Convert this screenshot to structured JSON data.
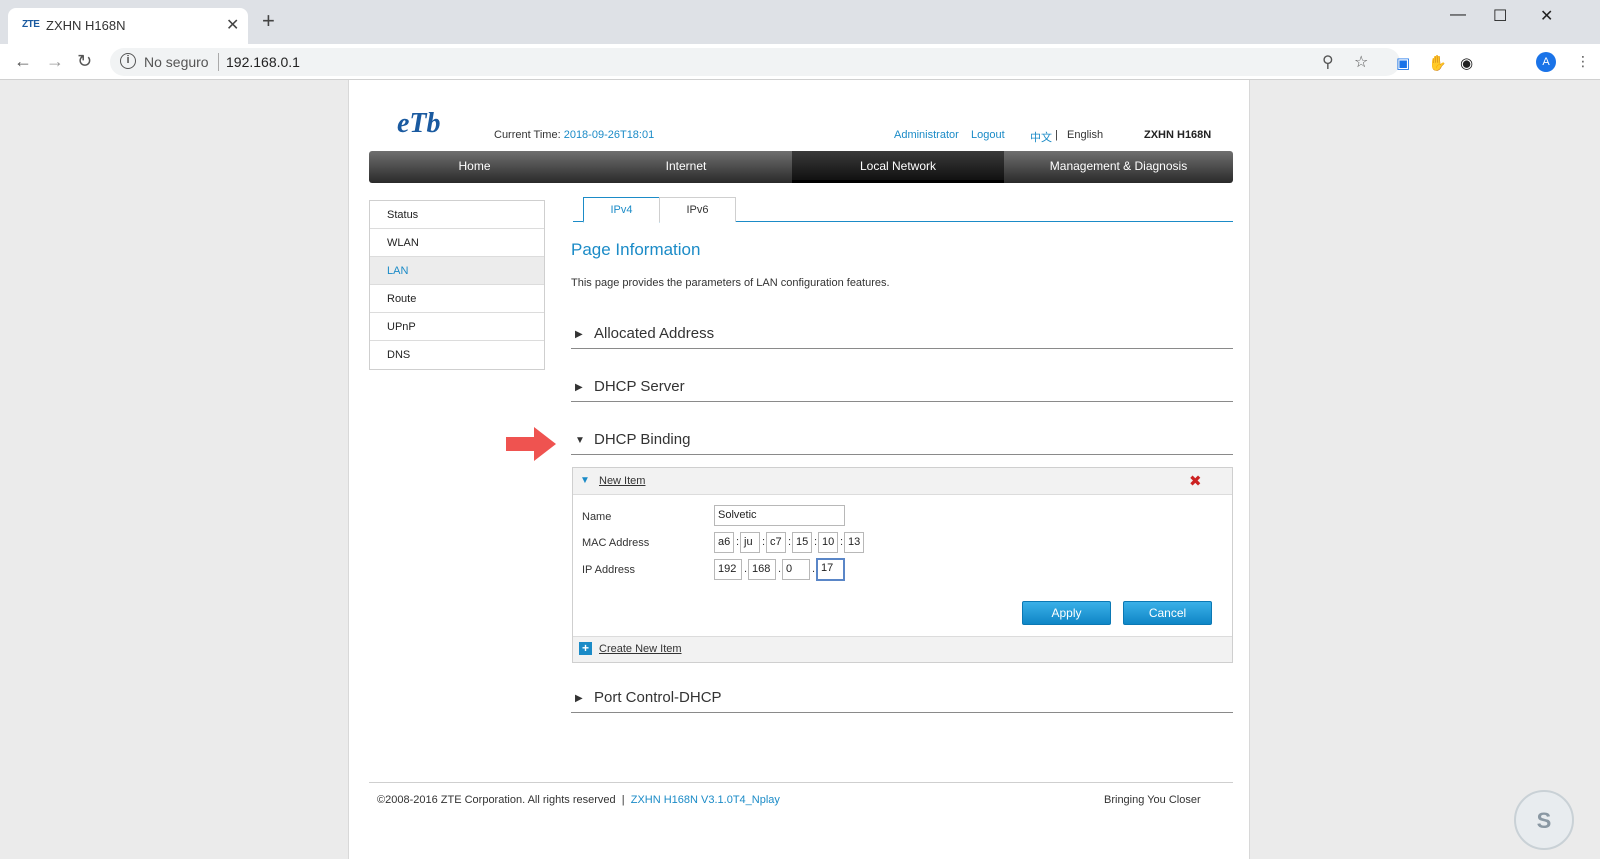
{
  "browser": {
    "tab_favicon": "ZTE",
    "tab_title": "ZXHN H168N",
    "tab_close": "✕",
    "new_tab": "+",
    "security_label": "No seguro",
    "url": "192.168.0.1",
    "avatar_letter": "A",
    "window_controls": [
      "—",
      "☐",
      "✕"
    ]
  },
  "header": {
    "logo": "eTb",
    "current_time_label": "Current Time:",
    "current_time_value": "2018-09-26T18:01",
    "user": "Administrator",
    "logout": "Logout",
    "lang_cn": "中文",
    "lang_sep": "|",
    "lang_en": "English",
    "model": "ZXHN H168N"
  },
  "nav": {
    "items": [
      "Home",
      "Internet",
      "Local Network",
      "Management & Diagnosis"
    ],
    "active": "Local Network"
  },
  "sidebar": {
    "items": [
      "Status",
      "WLAN",
      "LAN",
      "Route",
      "UPnP",
      "DNS"
    ],
    "active": "LAN"
  },
  "subtabs": [
    "IPv4",
    "IPv6"
  ],
  "page_info": {
    "title": "Page Information",
    "description": "This page provides the parameters of LAN configuration features."
  },
  "sections": {
    "allocated": "Allocated Address",
    "dhcp_server": "DHCP Server",
    "dhcp_binding": "DHCP Binding",
    "port_control": "Port Control-DHCP"
  },
  "binding_item": {
    "header": "New Item",
    "name_label": "Name",
    "name_value": "Solvetic",
    "mac_label": "MAC Address",
    "mac_octets": [
      "a6",
      "ju",
      "c7",
      "15",
      "10",
      "13"
    ],
    "ip_label": "IP Address",
    "ip_octets": [
      "192",
      "168",
      "0",
      "17"
    ],
    "apply": "Apply",
    "cancel": "Cancel",
    "create_new": "Create New Item"
  },
  "footer": {
    "copyright": "©2008-2016 ZTE Corporation. All rights reserved",
    "separator": "|",
    "version": "ZXHN H168N V3.1.0T4_Nplay",
    "slogan": "Bringing You Closer"
  },
  "colors": {
    "accent": "#1b8bc7",
    "nav_dark": "#2a2a2a",
    "arrow": "#ef5350"
  }
}
